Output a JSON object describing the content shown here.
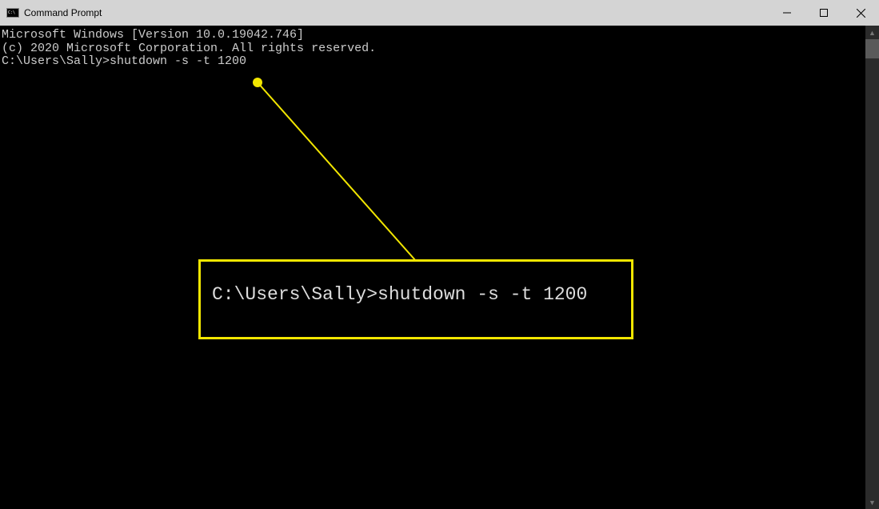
{
  "window": {
    "title": "Command Prompt"
  },
  "terminal": {
    "line1": "Microsoft Windows [Version 10.0.19042.746]",
    "line2": "(c) 2020 Microsoft Corporation. All rights reserved.",
    "blank": "",
    "prompt_line": "C:\\Users\\Sally>shutdown -s -t 1200"
  },
  "callout": {
    "text": "C:\\Users\\Sally>shutdown -s -t 1200"
  },
  "colors": {
    "highlight": "#f2e600",
    "terminal_bg": "#000000",
    "terminal_fg": "#cccccc"
  }
}
